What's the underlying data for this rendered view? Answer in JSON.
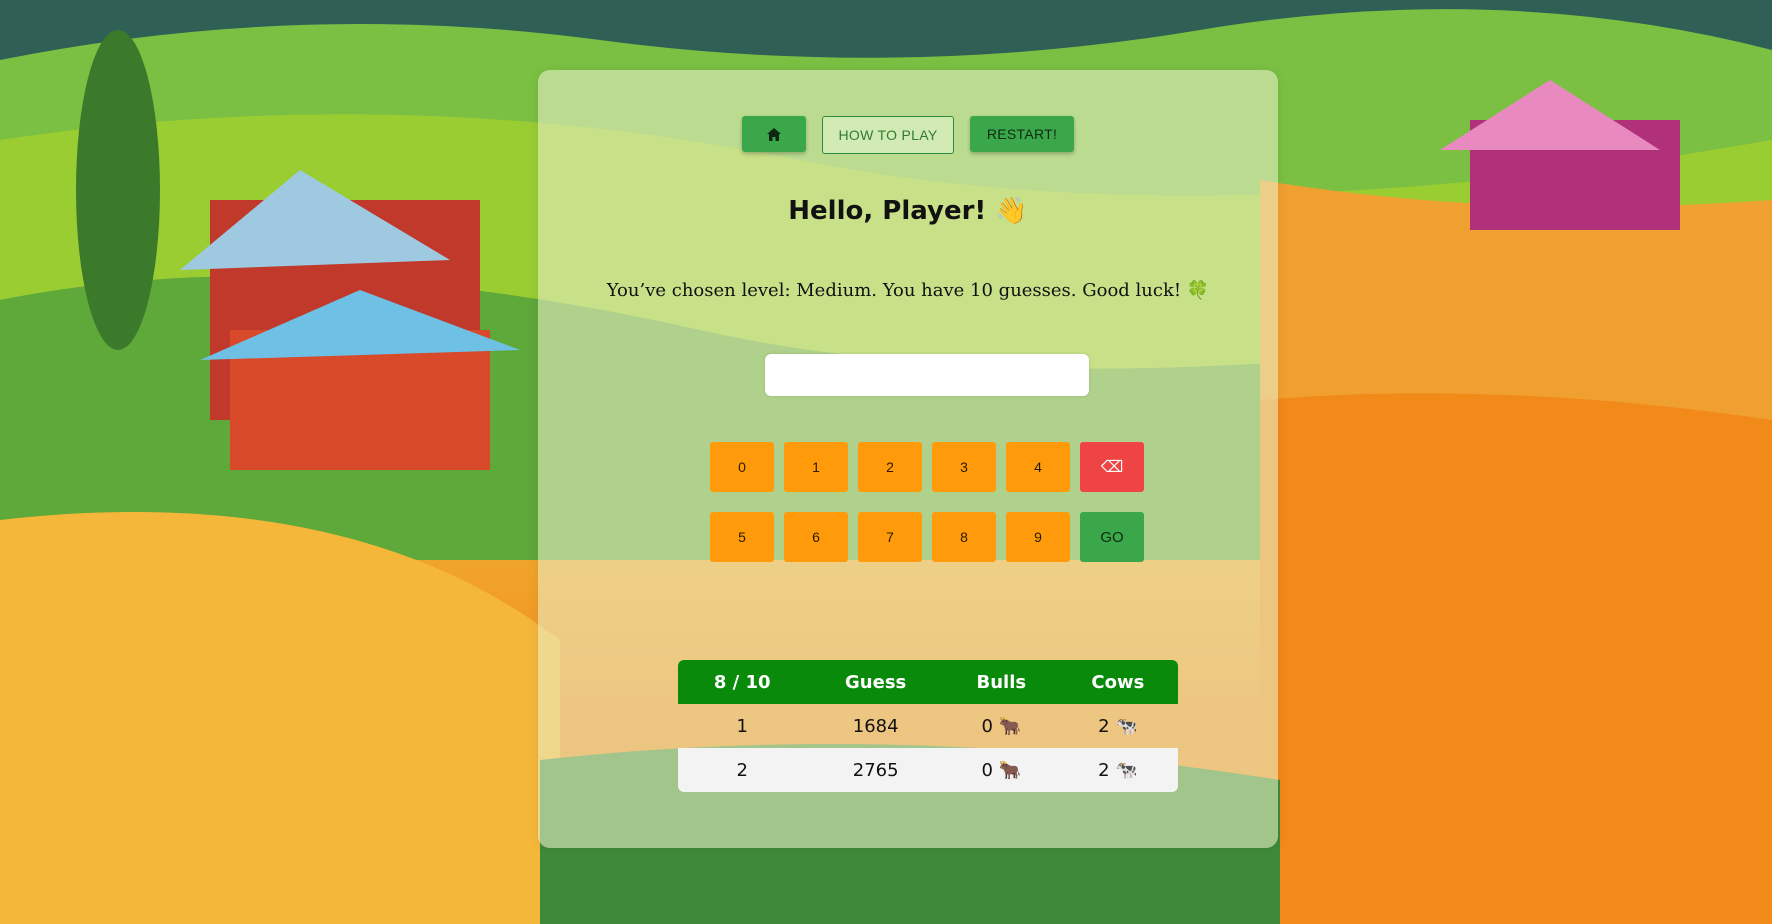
{
  "nav": {
    "home_icon": "home-icon",
    "how_to_play_label": "HOW TO PLAY",
    "restart_label": "RESTART!"
  },
  "greeting": "Hello, Player! 👋",
  "level_message": "You’ve chosen level: Medium. You have 10 guesses. Good luck! 🍀",
  "guess_input": {
    "value": "",
    "placeholder": ""
  },
  "keypad": {
    "row1": [
      "0",
      "1",
      "2",
      "3",
      "4"
    ],
    "row2": [
      "5",
      "6",
      "7",
      "8",
      "9"
    ],
    "backspace_label": "⌫",
    "go_label": "GO"
  },
  "results": {
    "headers": [
      "8 / 10",
      "Guess",
      "Bulls",
      "Cows"
    ],
    "rows": [
      {
        "num": "1",
        "guess": "1684",
        "bulls": "0 🐂",
        "cows": "2 🐄"
      },
      {
        "num": "2",
        "guess": "2765",
        "bulls": "0 🐂",
        "cows": "2 🐄"
      }
    ]
  },
  "colors": {
    "primary_green": "#3aa84a",
    "table_header": "#0a8a0a",
    "key_orange": "#ff9a0a",
    "backspace_red": "#ef4444"
  }
}
